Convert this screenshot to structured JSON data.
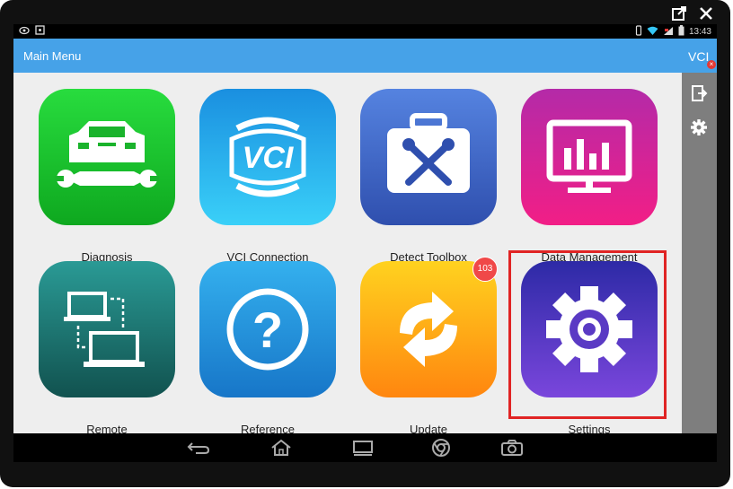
{
  "status_bar": {
    "time": "13:43",
    "left_icons": [
      "eye-icon",
      "screenshot-icon"
    ],
    "right_icons": [
      "vibrate-icon",
      "wifi-icon",
      "signal-icon",
      "battery-icon"
    ]
  },
  "header": {
    "title": "Main Menu",
    "color": "#46a2e8"
  },
  "side_panel": {
    "vci_label": "VCI",
    "vci_status": "disconnected",
    "buttons": [
      "exit-icon",
      "gear-icon"
    ]
  },
  "tiles": [
    {
      "label": "Diagnosis",
      "icon": "car-wrench-icon",
      "colors": [
        "#22d33a",
        "#0ea81f"
      ]
    },
    {
      "label": "VCI Connection",
      "icon": "vci-badge-icon",
      "colors": [
        "#35c6f5",
        "#1a8fe0"
      ]
    },
    {
      "label": "Detect Toolbox",
      "icon": "toolbox-icon",
      "colors": [
        "#4a77d8",
        "#2f4fae"
      ]
    },
    {
      "label": "Data Management",
      "icon": "bar-chart-monitor-icon",
      "colors": [
        "#c62aa0",
        "#ee1e8a"
      ]
    },
    {
      "label": "Remote",
      "icon": "remote-laptops-icon",
      "colors": [
        "#2a8f8b",
        "#14605e"
      ]
    },
    {
      "label": "Reference",
      "icon": "question-icon",
      "colors": [
        "#2fa6e8",
        "#1776c8"
      ]
    },
    {
      "label": "Update",
      "icon": "sync-arrows-icon",
      "colors": [
        "#ffc21a",
        "#ff8a0f"
      ],
      "badge": "103"
    },
    {
      "label": "Settings",
      "icon": "settings-gear-icon",
      "colors": [
        "#3b2fb0",
        "#7040d8"
      ],
      "highlighted": true
    }
  ],
  "nav_bar": {
    "buttons": [
      "back-icon",
      "home-icon",
      "recents-icon",
      "browser-icon",
      "camera-icon"
    ]
  },
  "window_controls": [
    "popout-icon",
    "close-icon"
  ]
}
